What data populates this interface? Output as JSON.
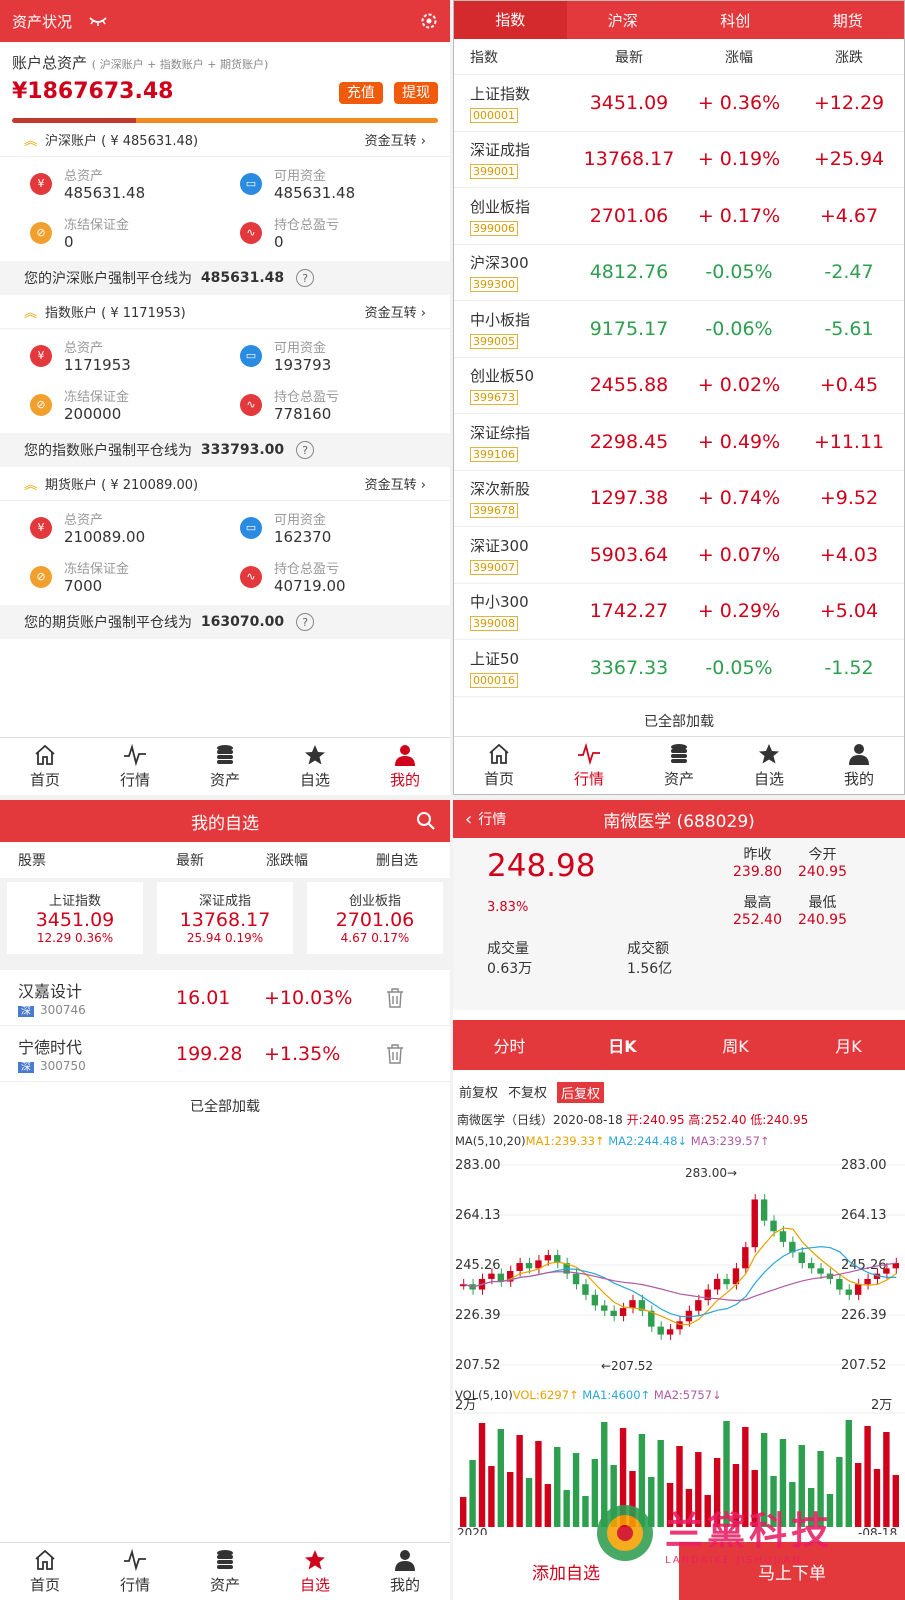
{
  "assets": {
    "title": "资产状况",
    "total_label": "账户总资产",
    "total_sub": "( 沪深账户 + 指数账户 + 期货账户)",
    "total_value": "¥1867673.48",
    "recharge": "充值",
    "withdraw": "提现",
    "accounts": [
      {
        "name": "沪深账户 ( ¥ 485631.48)",
        "transfer": "资金互转",
        "total_label": "总资产",
        "total": "485631.48",
        "avail_label": "可用资金",
        "avail": "485631.48",
        "frozen_label": "冻结保证金",
        "frozen": "0",
        "pnl_label": "持仓总盈亏",
        "pnl": "0",
        "line_label": "您的沪深账户强制平仓线为",
        "line": "485631.48"
      },
      {
        "name": "指数账户 ( ¥ 1171953)",
        "transfer": "资金互转",
        "total_label": "总资产",
        "total": "1171953",
        "avail_label": "可用资金",
        "avail": "193793",
        "frozen_label": "冻结保证金",
        "frozen": "200000",
        "pnl_label": "持仓总盈亏",
        "pnl": "778160",
        "line_label": "您的指数账户强制平仓线为",
        "line": "333793.00"
      },
      {
        "name": "期货账户 ( ¥ 210089.00)",
        "transfer": "资金互转",
        "total_label": "总资产",
        "total": "210089.00",
        "avail_label": "可用资金",
        "avail": "162370",
        "frozen_label": "冻结保证金",
        "frozen": "7000",
        "pnl_label": "持仓总盈亏",
        "pnl": "40719.00",
        "line_label": "您的期货账户强制平仓线为",
        "line": "163070.00"
      }
    ]
  },
  "tabs": {
    "home": "首页",
    "market": "行情",
    "assets": "资产",
    "watch": "自选",
    "mine": "我的"
  },
  "market": {
    "tabs": [
      "指数",
      "沪深",
      "科创",
      "期货"
    ],
    "cols": [
      "指数",
      "最新",
      "涨幅",
      "涨跌"
    ],
    "rows": [
      {
        "name": "上证指数",
        "code": "000001",
        "last": "3451.09",
        "pct": "+ 0.36%",
        "chg": "+12.29",
        "up": true
      },
      {
        "name": "深证成指",
        "code": "399001",
        "last": "13768.17",
        "pct": "+ 0.19%",
        "chg": "+25.94",
        "up": true
      },
      {
        "name": "创业板指",
        "code": "399006",
        "last": "2701.06",
        "pct": "+ 0.17%",
        "chg": "+4.67",
        "up": true
      },
      {
        "name": "沪深300",
        "code": "399300",
        "last": "4812.76",
        "pct": "-0.05%",
        "chg": "-2.47",
        "up": false
      },
      {
        "name": "中小板指",
        "code": "399005",
        "last": "9175.17",
        "pct": "-0.06%",
        "chg": "-5.61",
        "up": false
      },
      {
        "name": "创业板50",
        "code": "399673",
        "last": "2455.88",
        "pct": "+ 0.02%",
        "chg": "+0.45",
        "up": true
      },
      {
        "name": "深证综指",
        "code": "399106",
        "last": "2298.45",
        "pct": "+ 0.49%",
        "chg": "+11.11",
        "up": true
      },
      {
        "name": "深次新股",
        "code": "399678",
        "last": "1297.38",
        "pct": "+ 0.74%",
        "chg": "+9.52",
        "up": true
      },
      {
        "name": "深证300",
        "code": "399007",
        "last": "5903.64",
        "pct": "+ 0.07%",
        "chg": "+4.03",
        "up": true
      },
      {
        "name": "中小300",
        "code": "399008",
        "last": "1742.27",
        "pct": "+ 0.29%",
        "chg": "+5.04",
        "up": true
      },
      {
        "name": "上证50",
        "code": "000016",
        "last": "3367.33",
        "pct": "-0.05%",
        "chg": "-1.52",
        "up": false
      }
    ],
    "loaded": "已全部加载"
  },
  "watch": {
    "title": "我的自选",
    "cols": [
      "股票",
      "最新",
      "涨跌幅",
      "删自选"
    ],
    "cards": [
      {
        "name": "上证指数",
        "last": "3451.09",
        "sub": "12.29 0.36%"
      },
      {
        "name": "深证成指",
        "last": "13768.17",
        "sub": "25.94 0.19%"
      },
      {
        "name": "创业板指",
        "last": "2701.06",
        "sub": "4.67 0.17%"
      }
    ],
    "items": [
      {
        "name": "汉嘉设计",
        "mkt": "深",
        "code": "300746",
        "last": "16.01",
        "pct": "+10.03%"
      },
      {
        "name": "宁德时代",
        "mkt": "深",
        "code": "300750",
        "last": "199.28",
        "pct": "+1.35%"
      }
    ],
    "loaded": "已全部加载"
  },
  "detail": {
    "back": "行情",
    "title": "南微医学 (688029)",
    "price": "248.98",
    "pct": "3.83%",
    "prev_label": "昨收",
    "prev": "239.80",
    "open_label": "今开",
    "open": "240.95",
    "high_label": "最高",
    "high": "252.40",
    "low_label": "最低",
    "low": "240.95",
    "vol_label": "成交量",
    "vol": "0.63万",
    "amt_label": "成交额",
    "amt": "1.56亿",
    "ktabs": [
      "分时",
      "日K",
      "周K",
      "月K"
    ],
    "adj": [
      "前复权",
      "不复权",
      "后复权"
    ],
    "info": "南微医学（日线）2020-08-18",
    "ohlc": "开:240.95 高:252.40 低:240.95",
    "ma_title": "MA(5,10,20)",
    "ma1": "MA1:239.33↑",
    "ma2": "MA2:244.48↓",
    "ma3": "MA3:239.57↑",
    "yticks": [
      "283.00",
      "264.13",
      "245.26",
      "226.39",
      "207.52"
    ],
    "max_mark": "283.00→",
    "min_mark": "←207.52",
    "vol_title": "VOL(5,10)",
    "vol1": "VOL:6297↑",
    "vol2": "MA1:4600↑",
    "vol3": "MA2:5757↓",
    "vol_tick": "2万",
    "date_l": "2020",
    "date_r": "-08-18",
    "add": "添加自选",
    "buy": "马上下单",
    "watermark": "兰黛科技",
    "watermark_sub": "LANDAIKE JISHUJIAN"
  },
  "colors": {
    "primary": "#e4393c",
    "up": "#d0021b",
    "down": "#2e9e4f",
    "orange": "#f05a0a"
  }
}
